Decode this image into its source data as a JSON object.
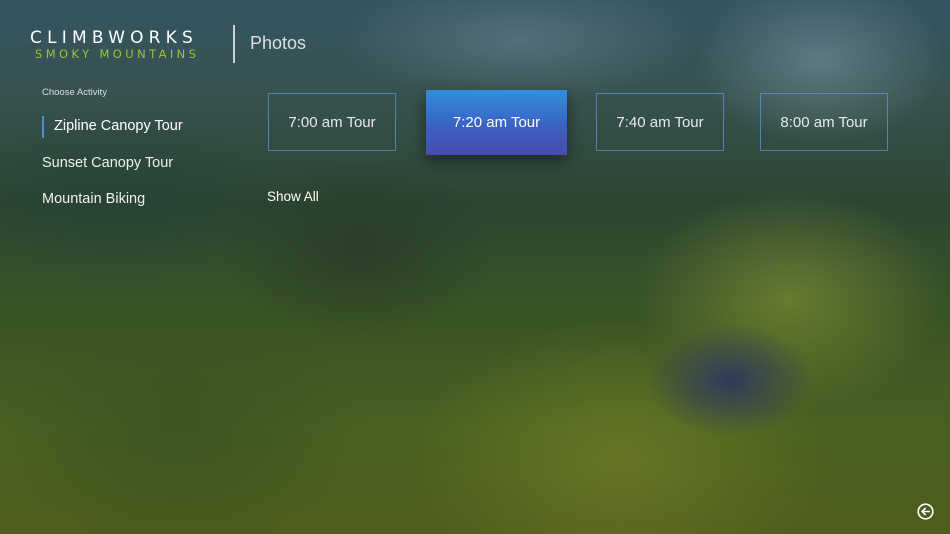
{
  "header": {
    "logo_top": "CLIMBWORKS",
    "logo_bottom": "SMOKY MOUNTAINS",
    "page_title": "Photos"
  },
  "sidebar": {
    "heading": "Choose Activity",
    "items": [
      {
        "label": "Zipline Canopy Tour",
        "selected": true
      },
      {
        "label": "Sunset Canopy Tour",
        "selected": false
      },
      {
        "label": "Mountain Biking",
        "selected": false
      }
    ]
  },
  "tours": [
    {
      "label": "7:00 am Tour",
      "focused": false
    },
    {
      "label": "7:20 am Tour",
      "focused": true
    },
    {
      "label": "7:40 am Tour",
      "focused": false
    },
    {
      "label": "8:00 am Tour",
      "focused": false
    }
  ],
  "show_all_label": "Show All",
  "icons": {
    "back": "back-arrow-icon"
  },
  "colors": {
    "accent_green": "#9cc433",
    "focus_gradient_top": "#2f8fde",
    "focus_gradient_bottom": "#4a4aae",
    "tile_border": "#5a96d2",
    "selection_bar": "#4a90d9"
  }
}
